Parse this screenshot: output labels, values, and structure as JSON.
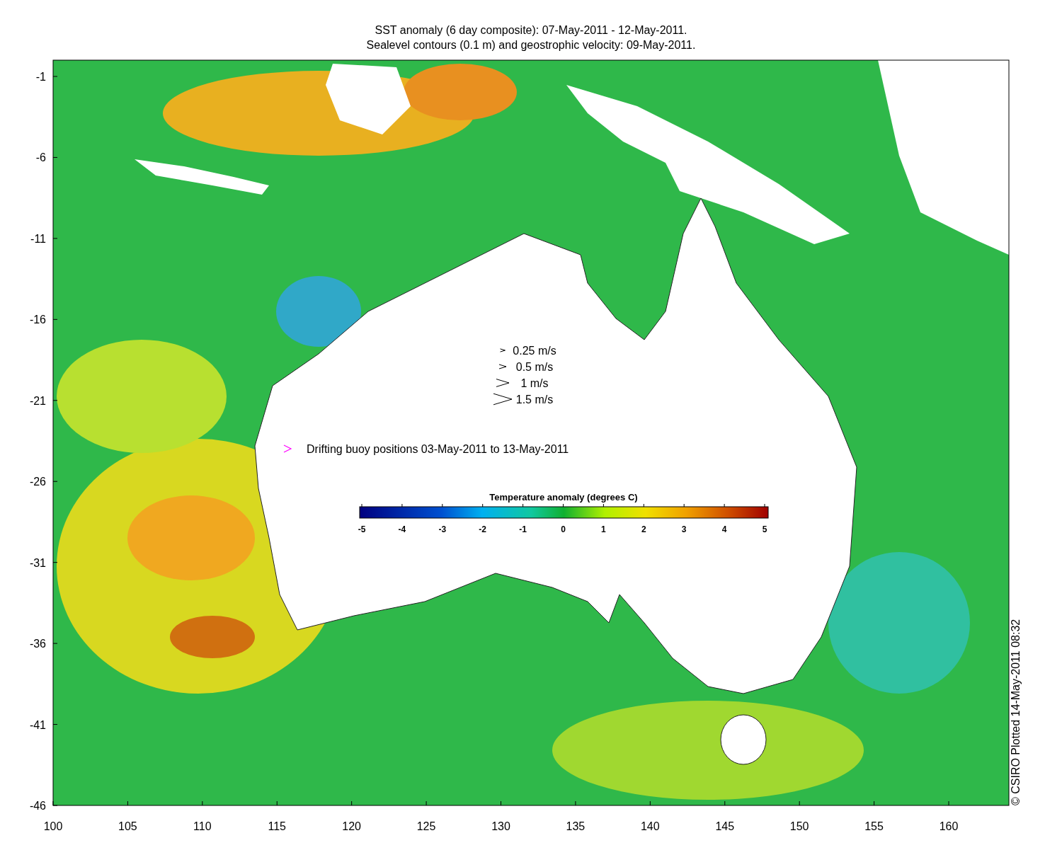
{
  "title_lines": [
    "SST anomaly (6 day composite): 07-May-2011 - 12-May-2011.",
    "Sealevel contours (0.1 m) and geostrophic velocity: 09-May-2011."
  ],
  "y_axis": {
    "ticks": [
      "-1",
      "-6",
      "-11",
      "-16",
      "-21",
      "-26",
      "-31",
      "-36",
      "-41",
      "-46"
    ]
  },
  "x_axis": {
    "ticks": [
      "100",
      "105",
      "110",
      "115",
      "120",
      "125",
      "130",
      "135",
      "140",
      "145",
      "150",
      "155",
      "160"
    ]
  },
  "velocity_legend": [
    {
      "label": "0.25 m/s"
    },
    {
      "label": "0.5 m/s"
    },
    {
      "label": "1 m/s"
    },
    {
      "label": "1.5 m/s"
    }
  ],
  "buoy_legend": {
    "label": "Drifting buoy positions 03-May-2011 to 13-May-2011"
  },
  "colorbar": {
    "title": "Temperature anomaly (degrees C)",
    "ticks": [
      "-5",
      "-4",
      "-3",
      "-2",
      "-1",
      "0",
      "1",
      "2",
      "3",
      "4",
      "5"
    ]
  },
  "credit": "© CSIRO Plotted 14-May-2011 08:32"
}
